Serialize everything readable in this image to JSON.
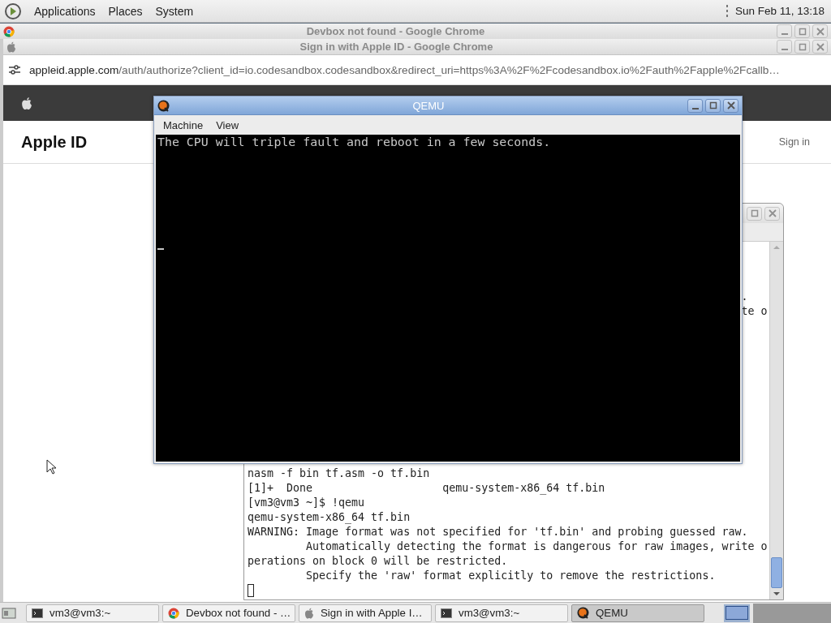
{
  "top_panel": {
    "menus": [
      "Applications",
      "Places",
      "System"
    ],
    "clock": "Sun Feb 11, 13:18"
  },
  "background_window": {
    "title": "Devbox not found - Google Chrome",
    "active": false
  },
  "browser": {
    "title": "Sign in with Apple ID - Google Chrome",
    "active": false,
    "url_host": "appleid.apple.com",
    "url_path": "/auth/authorize?client_id=io.codesandbox.codesandbox&redirect_uri=https%3A%2F%2Fcodesandbox.io%2Fauth%2Fapple%2Fcallb…",
    "page_heading": "Apple ID",
    "sign_in": "Sign in"
  },
  "terminal": {
    "fragments": [
      {
        "text": "."
      },
      {
        "text": "te o"
      }
    ],
    "lines": [
      "nasm -f bin tf.asm -o tf.bin",
      "[1]+  Done                    qemu-system-x86_64 tf.bin",
      "[vm3@vm3 ~]$ !qemu",
      "qemu-system-x86_64 tf.bin",
      "WARNING: Image format was not specified for 'tf.bin' and probing guessed raw.",
      "         Automatically detecting the format is dangerous for raw images, write o",
      "perations on block 0 will be restricted.",
      "         Specify the 'raw' format explicitly to remove the restrictions."
    ]
  },
  "qemu": {
    "title": "QEMU",
    "active": true,
    "menus": [
      "Machine",
      "View"
    ],
    "screen_lines": [
      "The CPU will triple fault and reboot in a few seconds."
    ]
  },
  "taskbar": {
    "tasks": [
      {
        "label": "vm3@vm3:~",
        "kind": "terminal",
        "selected": false
      },
      {
        "label": "Devbox not found - …",
        "kind": "chrome",
        "selected": false
      },
      {
        "label": "Sign in with Apple I…",
        "kind": "apple",
        "selected": false
      },
      {
        "label": "vm3@vm3:~",
        "kind": "terminal",
        "selected": false
      },
      {
        "label": "QEMU",
        "kind": "qemu",
        "selected": true
      }
    ]
  }
}
